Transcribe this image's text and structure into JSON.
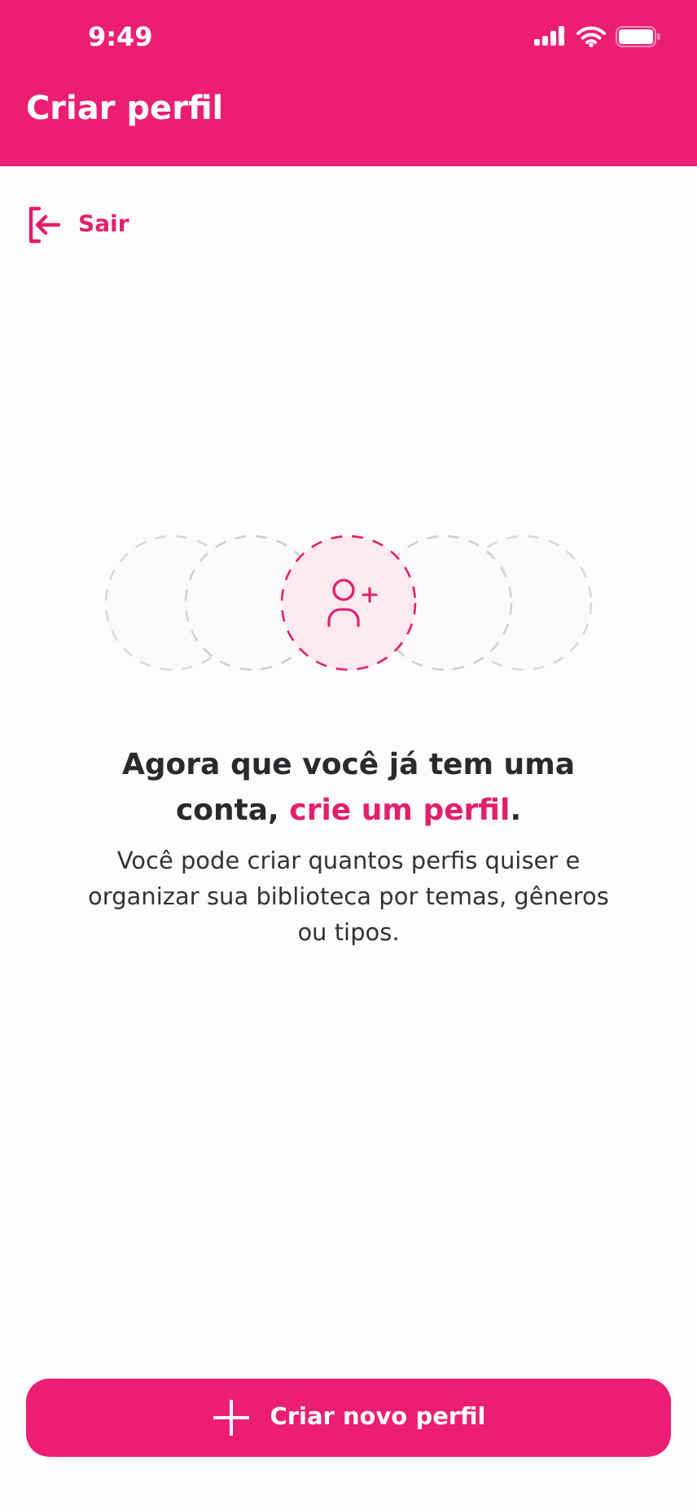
{
  "status_bar": {
    "time": "9:49"
  },
  "header": {
    "title": "Criar perfil"
  },
  "exit_link": {
    "label": "Sair"
  },
  "heading": {
    "before": "Agora que você já tem uma conta, ",
    "highlight": "crie um perfil",
    "after": "."
  },
  "description": "Você pode criar quantos perfis quiser e organizar sua biblioteca por temas, gêneros ou tipos.",
  "primary_button": {
    "label": "Criar novo perfil"
  }
}
